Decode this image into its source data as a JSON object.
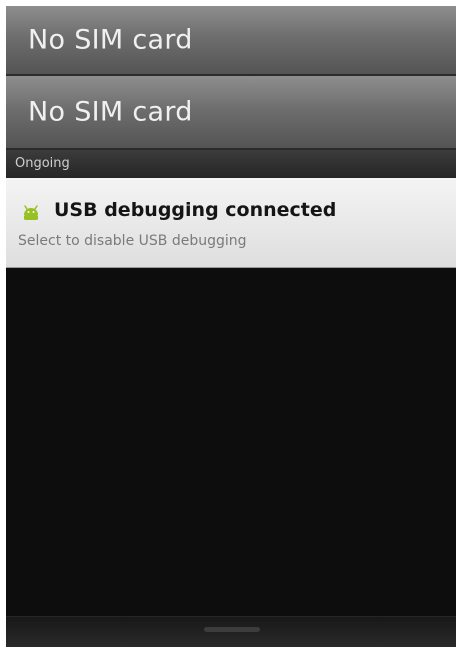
{
  "status_rows": [
    {
      "label": "No SIM card"
    },
    {
      "label": "No SIM card"
    }
  ],
  "section": {
    "label": "Ongoing"
  },
  "notification": {
    "icon": "android-icon",
    "title": "USB debugging connected",
    "text": "Select to disable USB debugging",
    "icon_color": "#97c024"
  },
  "bottom_bar": {
    "handle_icon": "drag-handle-icon"
  }
}
